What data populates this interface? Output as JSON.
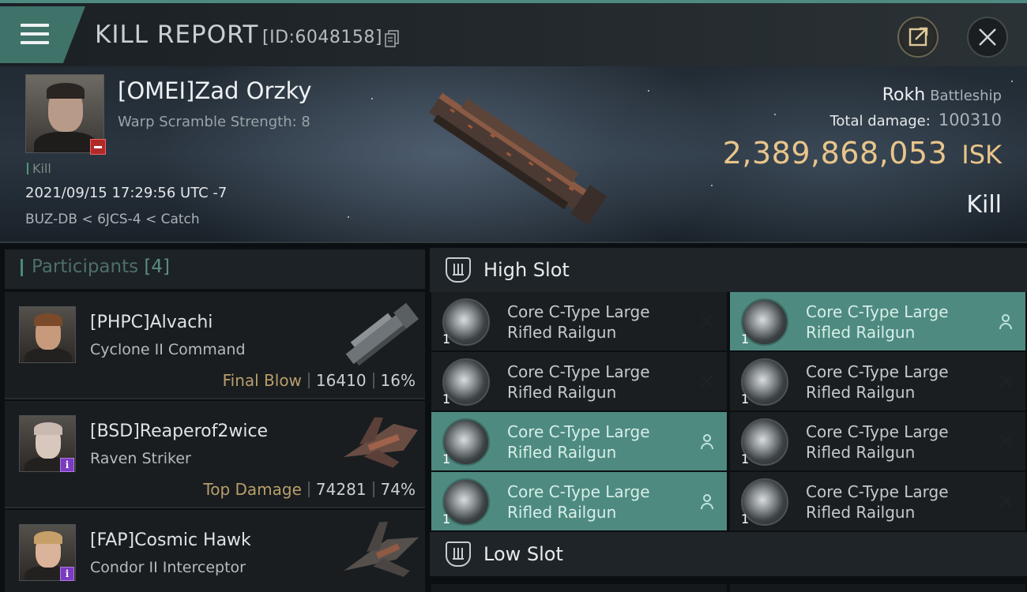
{
  "header": {
    "title": "KILL REPORT",
    "report_id": "[ID:6048158]"
  },
  "victim": {
    "name": "[OMEI]Zad Orzky",
    "warp_scramble": "Warp Scramble Strength: 8",
    "kill_tag": "Kill",
    "datetime": "2021/09/15 17:29:56 UTC -7",
    "location": "BUZ-DB < 6JCS-4 < Catch",
    "ship_name": "Rokh",
    "ship_class": "Battleship",
    "total_damage_label": "Total damage:",
    "total_damage_value": "100310",
    "isk_value": "2,389,868,053",
    "isk_unit": "ISK",
    "result_label": "Kill"
  },
  "participants": {
    "title": "Participants",
    "count": "[4]",
    "items": [
      {
        "name": "[PHPC]Alvachi",
        "ship": "Cyclone II Command",
        "role": "Final Blow",
        "damage": "16410",
        "percent": "16%"
      },
      {
        "name": "[BSD]Reaperof2wice",
        "ship": "Raven Striker",
        "role": "Top Damage",
        "damage": "74281",
        "percent": "74%"
      },
      {
        "name": "[FAP]Cosmic Hawk",
        "ship": "Condor II Interceptor"
      }
    ]
  },
  "slots": {
    "high_slot_title": "High Slot",
    "low_slot_title": "Low Slot",
    "high_modules": [
      {
        "name_line1": "Core C-Type Large",
        "name_line2": "Rifled Railgun",
        "qty": "1",
        "status": "destroyed"
      },
      {
        "name_line1": "Core C-Type Large",
        "name_line2": "Rifled Railgun",
        "qty": "1",
        "status": "dropped"
      },
      {
        "name_line1": "Core C-Type Large",
        "name_line2": "Rifled Railgun",
        "qty": "1",
        "status": "destroyed"
      },
      {
        "name_line1": "Core C-Type Large",
        "name_line2": "Rifled Railgun",
        "qty": "1",
        "status": "destroyed"
      },
      {
        "name_line1": "Core C-Type Large",
        "name_line2": "Rifled Railgun",
        "qty": "1",
        "status": "dropped"
      },
      {
        "name_line1": "Core C-Type Large",
        "name_line2": "Rifled Railgun",
        "qty": "1",
        "status": "destroyed"
      },
      {
        "name_line1": "Core C-Type Large",
        "name_line2": "Rifled Railgun",
        "qty": "1",
        "status": "dropped"
      },
      {
        "name_line1": "Core C-Type Large",
        "name_line2": "Rifled Railgun",
        "qty": "1",
        "status": "destroyed"
      }
    ]
  },
  "colors": {
    "accent_teal": "#4e8a80",
    "isk_gold": "#e9c58a",
    "role_gold": "#b89e6a"
  }
}
